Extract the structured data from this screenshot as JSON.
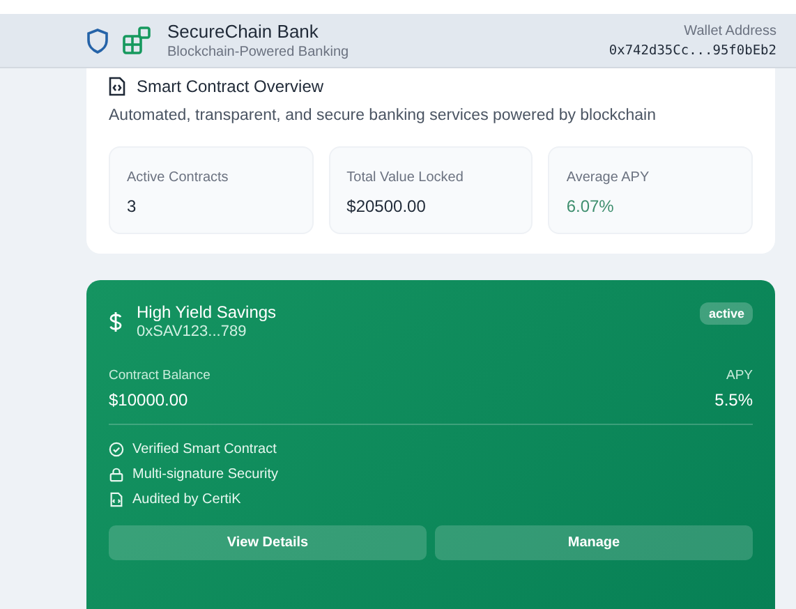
{
  "header": {
    "title": "SecureChain Bank",
    "subtitle": "Blockchain-Powered Banking",
    "wallet_label": "Wallet Address",
    "wallet_address": "0x742d35Cc...95f0bEb2"
  },
  "overview": {
    "title": "Smart Contract Overview",
    "description": "Automated, transparent, and secure banking services powered by blockchain",
    "stats": [
      {
        "label": "Active Contracts",
        "value": "3",
        "kind": "plain"
      },
      {
        "label": "Total Value Locked",
        "value": "$20500.00",
        "kind": "plain"
      },
      {
        "label": "Average APY",
        "value": "6.07%",
        "kind": "accent"
      }
    ]
  },
  "contract": {
    "name": "High Yield Savings",
    "address": "0xSAV123...789",
    "status": "active",
    "balance_label": "Contract Balance",
    "balance": "$10000.00",
    "apy_label": "APY",
    "apy": "5.5%",
    "features": [
      {
        "label": "Verified Smart Contract",
        "kind": "check"
      },
      {
        "label": "Multi-signature Security",
        "kind": "lock"
      },
      {
        "label": "Audited by CertiK",
        "kind": "document"
      }
    ],
    "buttons": [
      "View Details",
      "Manage"
    ]
  }
}
